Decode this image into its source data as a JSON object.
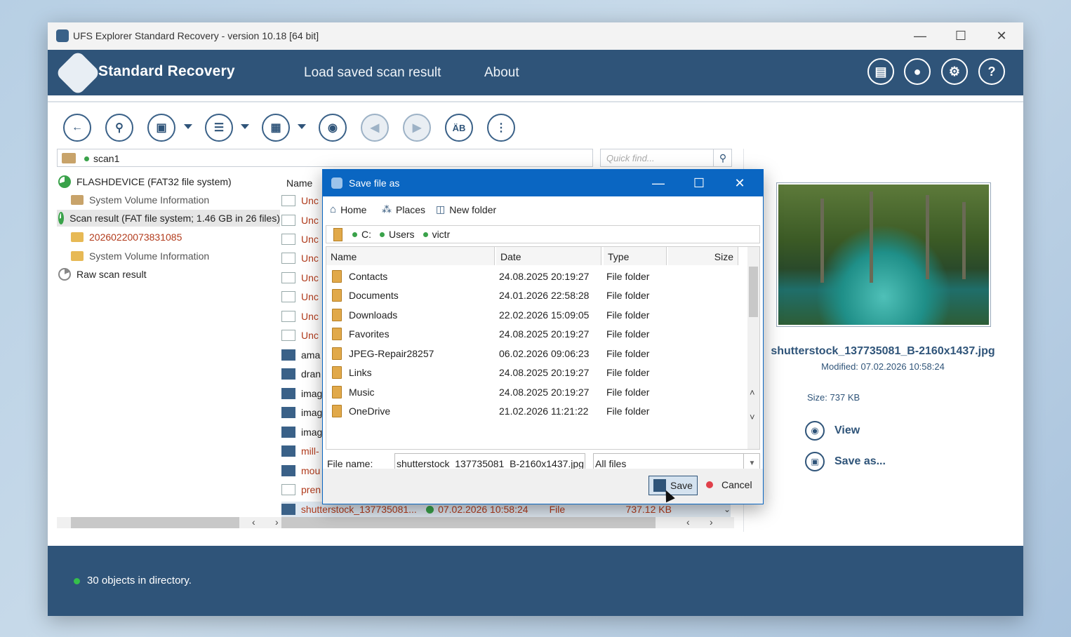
{
  "window": {
    "title": "UFS Explorer Standard Recovery - version 10.18 [64 bit]"
  },
  "header": {
    "brand": "Standard Recovery",
    "nav": [
      "Load saved scan result",
      "About"
    ]
  },
  "path": {
    "segment": "scan1",
    "quick_find_placeholder": "Quick find..."
  },
  "tree": [
    {
      "label": "FLASHDEVICE (FAT32 file system)"
    },
    {
      "label": "System Volume Information"
    },
    {
      "label": "Scan result (FAT file system; 1.46 GB in 26 files)"
    },
    {
      "label": "20260220073831085"
    },
    {
      "label": "System Volume Information"
    },
    {
      "label": "Raw scan result"
    }
  ],
  "list": {
    "header_name": "Name",
    "rows": [
      "Unc",
      "Unc",
      "Unc",
      "Unc",
      "Unc",
      "Unc",
      "Unc",
      "Unc",
      "ama",
      "dran",
      "imag",
      "imag",
      "imag",
      "mill-",
      "mou",
      "pren"
    ],
    "selected": {
      "name": "shutterstock_137735081...",
      "date": "07.02.2026 10:58:24",
      "type": "File",
      "size": "737.12 KB"
    }
  },
  "dialog": {
    "title": "Save file as",
    "toolbar": {
      "home": "Home",
      "places": "Places",
      "new_folder": "New folder"
    },
    "path": [
      "C:",
      "Users",
      "victr"
    ],
    "columns": {
      "name": "Name",
      "date": "Date",
      "type": "Type",
      "size": "Size"
    },
    "files": [
      {
        "name": "Contacts",
        "date": "24.08.2025 20:19:27",
        "type": "File folder"
      },
      {
        "name": "Documents",
        "date": "24.01.2026 22:58:28",
        "type": "File folder"
      },
      {
        "name": "Downloads",
        "date": "22.02.2026 15:09:05",
        "type": "File folder"
      },
      {
        "name": "Favorites",
        "date": "24.08.2025 20:19:27",
        "type": "File folder"
      },
      {
        "name": "JPEG-Repair28257",
        "date": "06.02.2026 09:06:23",
        "type": "File folder"
      },
      {
        "name": "Links",
        "date": "24.08.2025 20:19:27",
        "type": "File folder"
      },
      {
        "name": "Music",
        "date": "24.08.2025 20:19:27",
        "type": "File folder"
      },
      {
        "name": "OneDrive",
        "date": "21.02.2026 11:21:22",
        "type": "File folder"
      }
    ],
    "file_name_label": "File name:",
    "file_name_value": "shutterstock_137735081_B-2160x1437.jpg",
    "filter": "All files",
    "save_label": "Save",
    "cancel_label": "Cancel"
  },
  "preview": {
    "filename": "shutterstock_137735081_B-2160x1437.jpg",
    "modified": "Modified: 07.02.2026 10:58:24",
    "size": "Size: 737 KB",
    "view_label": "View",
    "save_as_label": "Save as..."
  },
  "status": {
    "text": "30 objects in directory."
  },
  "colors": {
    "header": "#2f5479",
    "dialog_title": "#0a66c2",
    "accent_red": "#b23b1c",
    "ok_green": "#35c04a"
  }
}
